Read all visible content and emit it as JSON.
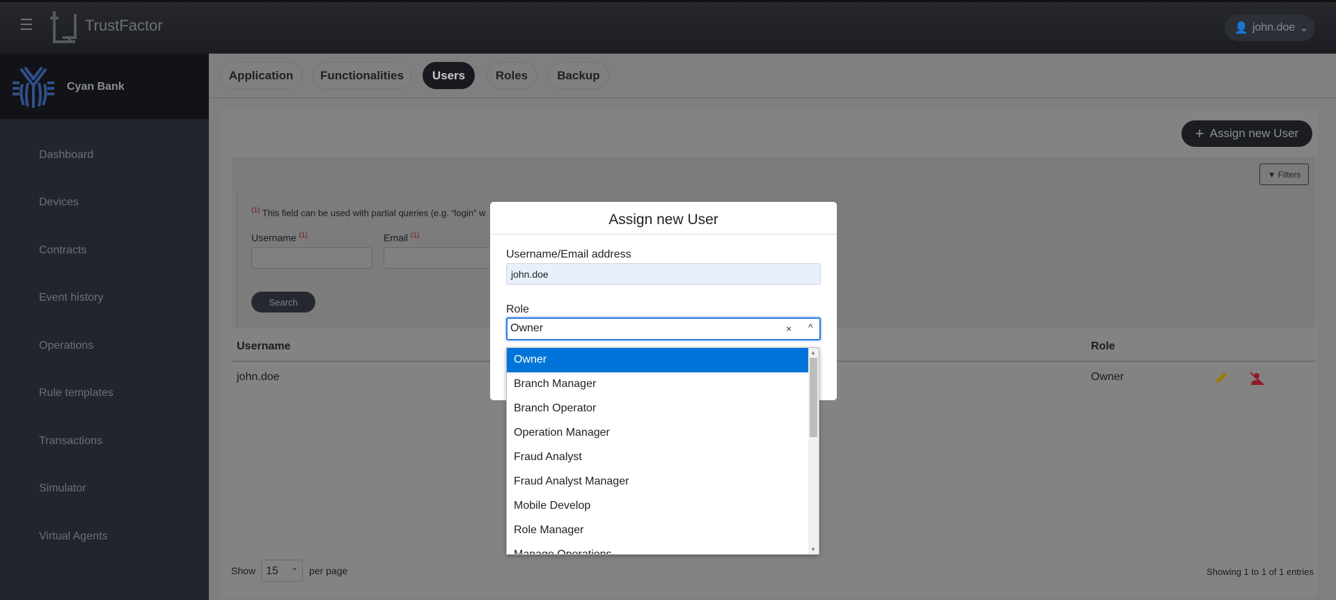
{
  "header": {
    "app_name": "TrustFactor",
    "user": "john.doe",
    "menu_icon": "hamburger-icon"
  },
  "sidebar": {
    "org_name": "Cyan Bank",
    "items": [
      {
        "label": "Dashboard"
      },
      {
        "label": "Devices"
      },
      {
        "label": "Contracts"
      },
      {
        "label": "Event history"
      },
      {
        "label": "Operations"
      },
      {
        "label": "Rule templates"
      },
      {
        "label": "Transactions"
      },
      {
        "label": "Simulator"
      },
      {
        "label": "Virtual Agents"
      }
    ]
  },
  "tabs": [
    {
      "label": "Application"
    },
    {
      "label": "Functionalities"
    },
    {
      "label": "Users",
      "active": true
    },
    {
      "label": "Roles"
    },
    {
      "label": "Backup"
    }
  ],
  "main": {
    "assign_button": "Assign new User",
    "filters_button": "Filters",
    "note_marker": "(1)",
    "note": "This field can be used with partial queries (e.g. “login” w",
    "filters": [
      {
        "label": "Username",
        "marker": "(1)",
        "value": ""
      },
      {
        "label": "Email",
        "marker": "(1)",
        "value": ""
      }
    ],
    "search_button": "Search",
    "table": {
      "columns": [
        "Username",
        "Role"
      ],
      "rows": [
        {
          "username": "john.doe",
          "role": "Owner"
        }
      ]
    },
    "footer": {
      "show": "Show",
      "per_page_value": "15",
      "per_page": "per page",
      "entries": "Showing 1 to 1 of 1 entries"
    }
  },
  "modal": {
    "title": "Assign new User",
    "username_label": "Username/Email address",
    "username_value": "john.doe",
    "role_label": "Role",
    "role_value": "Owner",
    "clear": "×",
    "options": [
      "Owner",
      "Branch Manager",
      "Branch Operator",
      "Operation Manager",
      "Fraud Analyst",
      "Fraud Analyst Manager",
      "Mobile Develop",
      "Role Manager",
      "Manage Operations"
    ],
    "selected_option": "Owner"
  },
  "colors": {
    "accent": "#0074d9",
    "focus": "#2a7ae2",
    "edit": "#9a7a08",
    "delete": "#8e1c26",
    "bank_logo": "#2f4f8a"
  }
}
